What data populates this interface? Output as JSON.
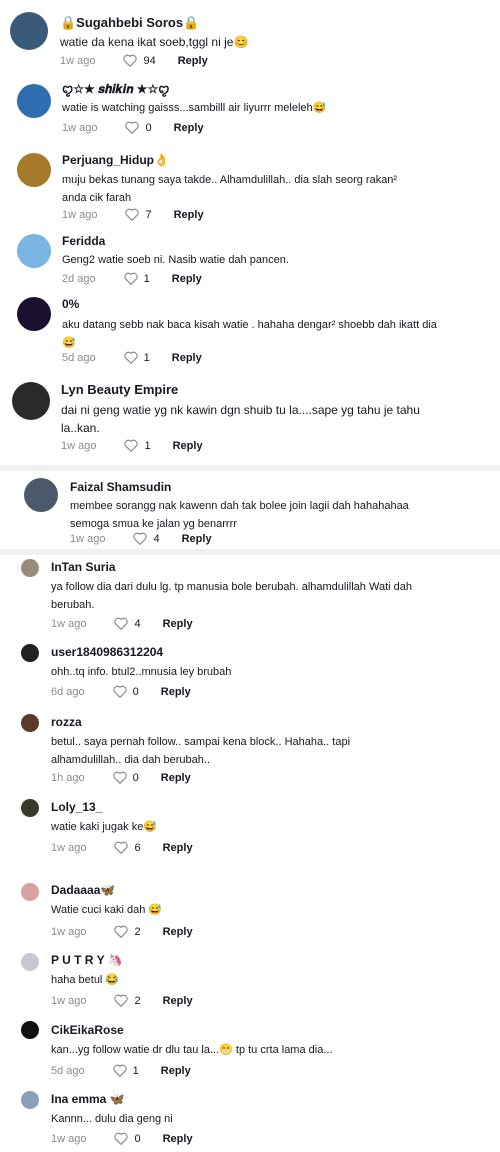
{
  "comments": [
    {
      "name": "🔒Sugahbebi Soros🔒",
      "text": "watie da kena ikat soeb,tggl ni je😊",
      "time": "1w ago",
      "likes": "94",
      "reply": "Reply"
    },
    {
      "name": "ꨄ︎☆★ 𝒔𝒉𝒊𝒌𝒊𝒏 ★☆ꨄ︎",
      "text": "watie is watching gaisss...sambilll air liyurrr meleleh😅",
      "time": "1w ago",
      "likes": "0",
      "reply": "Reply"
    },
    {
      "name": "Perjuang_Hidup👌",
      "text": "muju bekas tunang saya takde.. Alhamdulillah.. dia slah seorg rakan² anda cik farah",
      "time": "1w ago",
      "likes": "7",
      "reply": "Reply"
    },
    {
      "name": "Feridda",
      "text": "Geng2 watie soeb ni. Nasib watie dah pancen.",
      "time": "2d ago",
      "likes": "1",
      "reply": "Reply"
    },
    {
      "name": "0%",
      "text": "aku datang sebb nak baca kisah watie . hahaha dengar² shoebb dah ikatt dia 😅",
      "time": "5d ago",
      "likes": "1",
      "reply": "Reply"
    },
    {
      "name": "Lyn Beauty Empire",
      "text": "dai ni geng watie yg nk kawin dgn shuib tu la....sape yg tahu je tahu la..kan.",
      "time": "1w ago",
      "likes": "1",
      "reply": "Reply"
    },
    {
      "name": "Faizal Shamsudin",
      "text": "membee sorangg nak kawenn dah tak bolee join lagii dah hahahahaa semoga smua ke jalan yg benarrrr",
      "time": "1w ago",
      "likes": "4",
      "reply": "Reply"
    },
    {
      "name": "InTan Suria",
      "text": "ya follow dia dari dulu lg. tp manusia bole berubah. alhamdulillah Wati dah berubah.",
      "time": "1w ago",
      "likes": "4",
      "reply": "Reply"
    },
    {
      "name": "user1840986312204",
      "text": "ohh..tq info. btul2..mnusia ley brubah",
      "time": "6d ago",
      "likes": "0",
      "reply": "Reply"
    },
    {
      "name": "rozza",
      "text": "betul.. saya pernah follow.. sampai kena block.. Hahaha.. tapi alhamdulillah.. dia dah berubah..",
      "time": "1h ago",
      "likes": "0",
      "reply": "Reply"
    },
    {
      "name": "Loly_13_",
      "text": "watie kaki jugak ke😅",
      "time": "1w ago",
      "likes": "6",
      "reply": "Reply"
    },
    {
      "name": "Dadaaaa🦋",
      "text": "Watie cuci kaki dah 😅",
      "time": "1w ago",
      "likes": "2",
      "reply": "Reply"
    },
    {
      "name": "P U T R Y 🦄",
      "text": "haha betul 😂",
      "time": "1w ago",
      "likes": "2",
      "reply": "Reply"
    },
    {
      "name": "CikEikaRose",
      "text": "kan...yg follow watie dr dlu tau la...😁 tp tu crta lama dia...",
      "time": "5d ago",
      "likes": "1",
      "reply": "Reply"
    },
    {
      "name": "Ina emma 🦋",
      "text": "Kannn... dulu dia geng ni",
      "time": "1w ago",
      "likes": "0",
      "reply": "Reply"
    }
  ],
  "avatars": [
    "#3a5a7a",
    "#2f6db0",
    "#a57a2a",
    "#79b5e0",
    "#1a1030",
    "#2a2a2a",
    "#4a5a6a",
    "#9a8a7a",
    "#222222",
    "#5a3a2a",
    "#3a3a2a",
    "#d9a0a0",
    "#c8c8d0",
    "#111111",
    "#8aa0b8"
  ],
  "icons": {
    "heart": "heart-icon"
  }
}
